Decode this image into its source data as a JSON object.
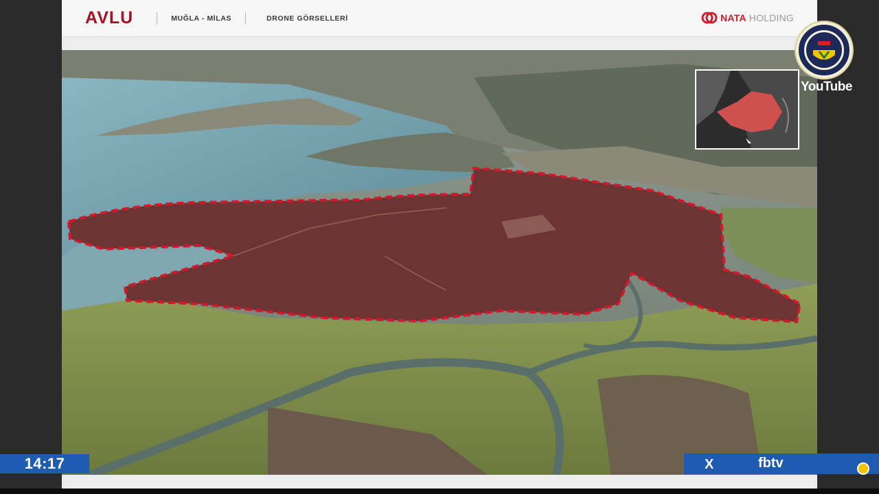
{
  "header": {
    "brand": "AVLU",
    "location": "MUĞLA - MİLAS",
    "section": "DRONE GÖRSELLERİ",
    "company_strong": "NATA",
    "company_rest": " HOLDING"
  },
  "overlay": {
    "channel_badge_label": "YouTube",
    "clock": "14:17",
    "x_icon": "X",
    "channel_name": "fbtv"
  },
  "colors": {
    "brand_red": "#a51226",
    "outline_red": "#d4182a",
    "tv_blue": "#1f5bb0"
  },
  "icons": [
    "nata-logo-icon",
    "fenerbahce-badge-icon",
    "x-icon",
    "fenerbahce-mini-icon",
    "locator-map-icon"
  ]
}
